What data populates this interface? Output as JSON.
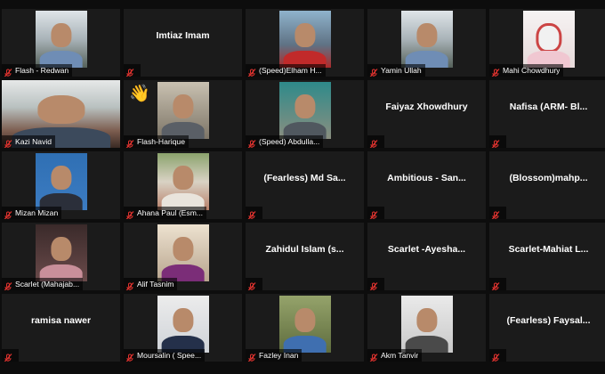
{
  "participants": [
    {
      "name": "Flash - Redwan",
      "video": "v-outdoor",
      "muted": true
    },
    {
      "name": "Imtiaz Imam",
      "center": "Imtiaz Imam",
      "muted": true
    },
    {
      "name": "(Speed)Elham H...",
      "video": "v-red",
      "muted": true
    },
    {
      "name": "Yamin Ullah",
      "video": "v-outdoor",
      "muted": true
    },
    {
      "name": "Mahi Chowdhury",
      "video": "v-pink",
      "muted": true
    },
    {
      "name": "Kazi Navid",
      "video": "wide",
      "muted": true
    },
    {
      "name": "Flash-Harique",
      "video": "v-room",
      "muted": true,
      "reaction": "👋"
    },
    {
      "name": "(Speed) Abdulla...",
      "video": "v-teal",
      "muted": true
    },
    {
      "name": "Faiyaz Xhowdhury",
      "center": "Faiyaz Xhowdhury",
      "muted": true
    },
    {
      "name": "Nafisa (ARM- Bl...",
      "center": "Nafisa (ARM- Bl...",
      "muted": true
    },
    {
      "name": "Mizan Mizan",
      "video": "v-blue",
      "muted": true
    },
    {
      "name": "Ahana Paul (Esm...",
      "video": "v-garden",
      "muted": true
    },
    {
      "name": "(Fearless) Md Sa...",
      "center": "(Fearless) Md Sa...",
      "muted": true
    },
    {
      "name": "Ambitious - San...",
      "center": "Ambitious - San...",
      "muted": true
    },
    {
      "name": "(Blossom)mahp...",
      "center": "(Blossom)mahp...",
      "muted": true
    },
    {
      "name": "Scarlet (Mahajab...",
      "video": "v-dark",
      "muted": true
    },
    {
      "name": "Alif Tasnim",
      "video": "v-purple",
      "muted": true
    },
    {
      "name": "Zahidul Islam (s...",
      "center": "Zahidul Islam (s...",
      "muted": true
    },
    {
      "name": "Scarlet -Ayesha...",
      "center": "Scarlet -Ayesha...",
      "muted": true
    },
    {
      "name": "Scarlet-Mahiat L...",
      "center": "Scarlet-Mahiat L...",
      "muted": true
    },
    {
      "name": "ramisa nawer",
      "center": "ramisa nawer",
      "muted": true
    },
    {
      "name": "Moursalin ( Spee...",
      "video": "v-navy",
      "muted": true
    },
    {
      "name": "Fazley Inan",
      "video": "v-field",
      "muted": true
    },
    {
      "name": "Akm Tanvir",
      "video": "v-white",
      "muted": true
    },
    {
      "name": "(Fearless) Faysal...",
      "center": "(Fearless) Faysal...",
      "muted": true
    }
  ],
  "colors": {
    "tile": "#1b1b1b",
    "background": "#0d0d0d",
    "muted_icon": "#e0332f"
  },
  "icons": {
    "muted": "mic-muted-icon",
    "reaction": "waving-hand-icon"
  }
}
